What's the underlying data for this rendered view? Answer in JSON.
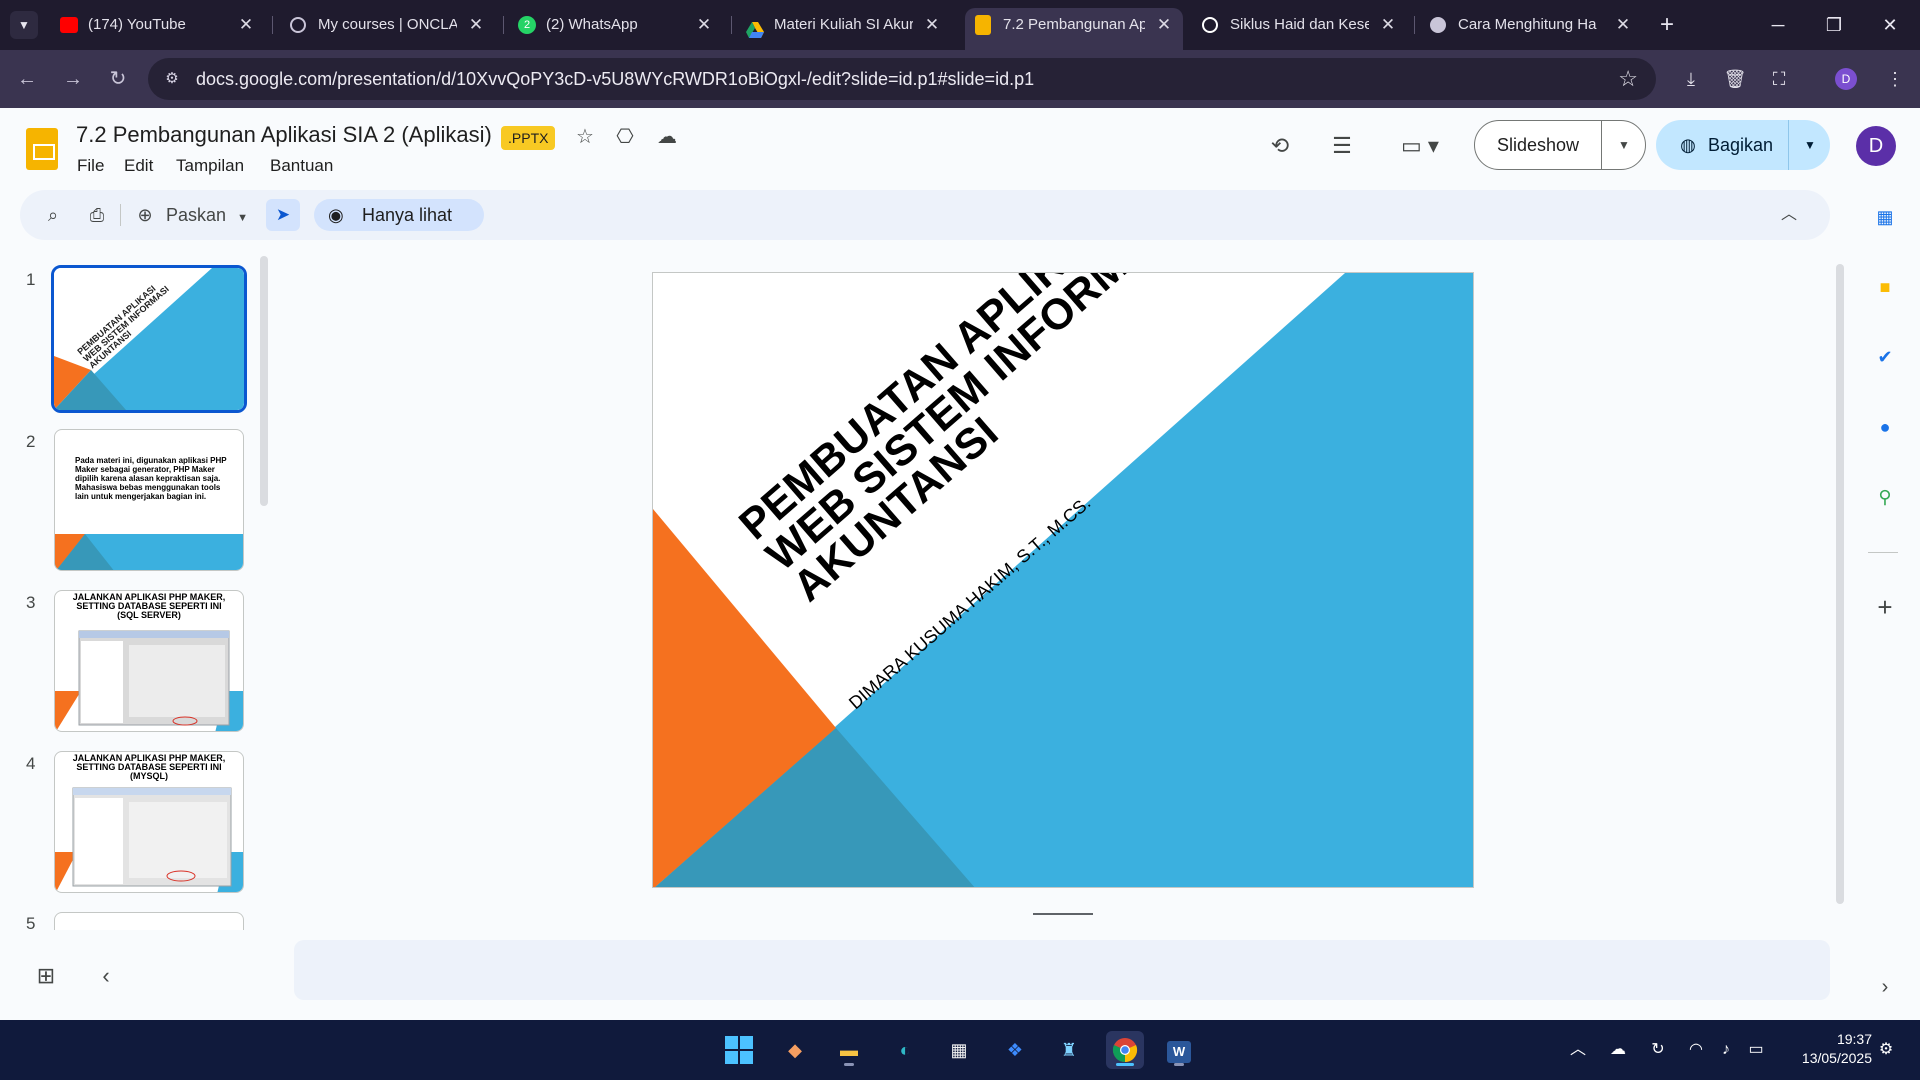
{
  "browser": {
    "tabs": [
      {
        "title": "(174) YouTube",
        "icon": "youtube-icon",
        "color": "#ff0000"
      },
      {
        "title": "My courses | ONCLA",
        "icon": "oncla-icon",
        "color": "#c9c5d8"
      },
      {
        "title": "(2) WhatsApp",
        "icon": "whatsapp-icon",
        "color": "#25d366",
        "badge": "2"
      },
      {
        "title": "Materi Kuliah SI Akur",
        "icon": "google-drive-icon",
        "color": "#1fa463"
      },
      {
        "title": "7.2 Pembangunan Ap",
        "icon": "google-slides-icon",
        "color": "#f6b400",
        "active": true
      },
      {
        "title": "Siklus Haid dan Kese",
        "icon": "chatgpt-icon",
        "color": "#ffffff"
      },
      {
        "title": "Cara Menghitung Ha",
        "icon": "globe-icon",
        "color": "#c9c5d8"
      }
    ],
    "close_glyph": "✕",
    "new_tab": "+",
    "url": "docs.google.com/presentation/d/10XvvQoPY3cD-v5U8WYcRWDR1oBiOgxl-/edit?slide=id.p1#slide=id.p1",
    "profile_initial": "D"
  },
  "app": {
    "title": "7.2 Pembangunan Aplikasi SIA 2 (Aplikasi)",
    "badge": ".PPTX",
    "menu": [
      "File",
      "Edit",
      "Tampilan",
      "Bantuan"
    ],
    "slideshow_label": "Slideshow",
    "share_label": "Bagikan",
    "avatar_initial": "D"
  },
  "toolbar": {
    "zoom_label": "Paskan",
    "view_only_label": "Hanya lihat"
  },
  "filmstrip": {
    "slides": [
      {
        "number": "1",
        "title_lines": [
          "PEMBUATAN APLIKASI",
          "WEB SISTEM INFORMASI",
          "AKUNTANSI"
        ]
      },
      {
        "number": "2",
        "text": "Pada materi ini, digunakan aplikasi PHP Maker sebagai generator, PHP Maker dipilih karena alasan kepraktisan saja. Mahasiswa bebas menggunakan tools lain untuk mengerjakan bagian ini."
      },
      {
        "number": "3",
        "title": "JALANKAN APLIKASI PHP MAKER, SETTING DATABASE SEPERTI INI (SQL SERVER)"
      },
      {
        "number": "4",
        "title": "JALANKAN APLIKASI PHP MAKER, SETTING DATABASE SEPERTI INI (MYSQL)"
      },
      {
        "number": "5"
      }
    ]
  },
  "slide": {
    "title_lines": [
      "PEMBUATAN APLIKASI",
      "WEB SISTEM INFORMASI",
      "AKUNTANSI"
    ],
    "author": "DIMARA KUSUMA HAKIM, S.T., M.CS.",
    "colors": {
      "blue": "#3bb0df",
      "orange": "#f5711f",
      "teal": "#3798b9"
    }
  },
  "taskbar": {
    "time": "19:37",
    "date": "13/05/2025"
  }
}
